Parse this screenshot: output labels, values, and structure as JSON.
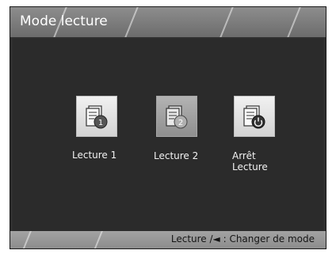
{
  "header": {
    "title": "Mode lecture"
  },
  "items": [
    {
      "label": "Lecture 1",
      "icon": "document-badge-1-icon"
    },
    {
      "label": "Lecture 2",
      "icon": "document-badge-2-icon"
    },
    {
      "label": "Arrêt\nLecture",
      "icon": "document-power-icon"
    }
  ],
  "footer": {
    "hint": "Lecture /◄ : Changer de mode"
  }
}
